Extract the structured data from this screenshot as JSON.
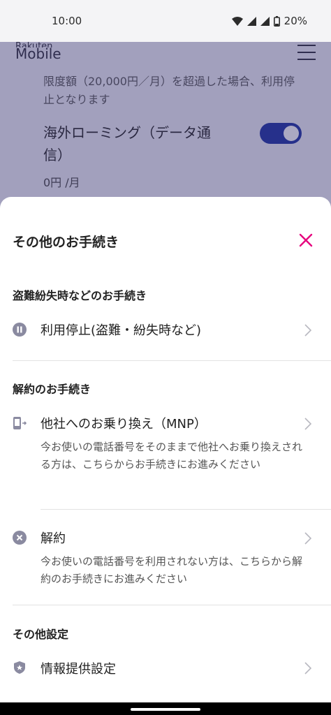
{
  "status_bar": {
    "time": "10:00",
    "battery": "20%"
  },
  "background_page": {
    "logo_line1": "Rakuten",
    "logo_line2": "Mobile",
    "limit_text": "限度額（20,000円／月）を超過した場合、利用停止となります",
    "roaming_label": "海外ローミング（データ通信）",
    "roaming_toggle_on": true,
    "roaming_price": "0円 /月"
  },
  "sheet": {
    "title": "その他のお手続き",
    "sections": [
      {
        "title": "盗難紛失時などのお手続き",
        "items": [
          {
            "label": "利用停止(盗難・紛失時など)",
            "icon": "pause-icon"
          }
        ]
      },
      {
        "title": "解約のお手続き",
        "items": [
          {
            "label": "他社へのお乗り換え（MNP）",
            "icon": "phone-transfer-icon",
            "description": "今お使いの電話番号をそのままで他社へお乗り換えされる方は、こちらからお手続きにお進みください"
          },
          {
            "label": "解約",
            "icon": "cancel-circle-icon",
            "description": "今お使いの電話番号を利用されない方は、こちらから解約のお手続きにお進みください"
          }
        ]
      },
      {
        "title": "その他設定",
        "items": [
          {
            "label": "情報提供設定",
            "icon": "shield-star-icon"
          }
        ]
      }
    ]
  },
  "colors": {
    "accent": "#e6007e",
    "icon_gray": "#8a8aa0",
    "toggle_blue": "#1a2fa0"
  }
}
